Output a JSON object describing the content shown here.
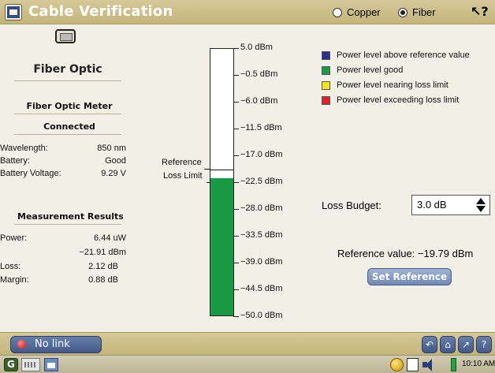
{
  "window": {
    "title": "Cable Verification",
    "app_icon": "window-icon",
    "help_icon": "help-arrow-icon"
  },
  "media": {
    "options": [
      {
        "label": "Copper",
        "selected": false
      },
      {
        "label": "Fiber",
        "selected": true
      }
    ]
  },
  "left_panel": {
    "device_icon": "fiber-meter-icon",
    "title": "Fiber Optic",
    "meter_heading": "Fiber Optic Meter",
    "meter_status": "Connected",
    "info": [
      {
        "label": "Wavelength:",
        "value": "850 nm"
      },
      {
        "label": "Battery:",
        "value": "Good"
      },
      {
        "label": "Battery Voltage:",
        "value": "9.29 V"
      }
    ],
    "results_heading": "Measurement Results",
    "power_label": "Power:",
    "power_uw": "6.44  uW",
    "power_dbm": "−21.91 dBm",
    "loss_label": "Loss:",
    "loss_value": "2.12 dB",
    "margin_label": "Margin:",
    "margin_value": "0.88 dB"
  },
  "meter": {
    "scale_max_dbm": 5.0,
    "scale_min_dbm": -50.0,
    "level_dbm": -21.91,
    "reference_dbm": -19.79,
    "loss_limit_dbm": -22.5,
    "ticks": [
      "5.0 dBm",
      "−0.5 dBm",
      "−6.0 dBm",
      "−11.5 dBm",
      "−17.0 dBm",
      "−22.5 dBm",
      "−28.0 dBm",
      "−33.5 dBm",
      "−39.0 dBm",
      "−44.5 dBm",
      "−50.0 dBm"
    ],
    "reference_label": "Reference",
    "loss_limit_label": "Loss Limit",
    "fill_color": "#199b46"
  },
  "legend": [
    {
      "color": "#2b2f8f",
      "label": "Power level above reference value"
    },
    {
      "color": "#199b46",
      "label": "Power level good"
    },
    {
      "color": "#f2e313",
      "label": "Power level nearing loss limit"
    },
    {
      "color": "#e3202b",
      "label": "Power level exceeding loss limit"
    }
  ],
  "loss_budget": {
    "label": "Loss Budget:",
    "value": "3.0 dB"
  },
  "reference": {
    "text": "Reference value: −19.79 dBm",
    "button": "Set Reference"
  },
  "status": {
    "link_label": "No link",
    "nav_icons": [
      "back-icon",
      "home-icon",
      "tools-icon",
      "help-icon"
    ],
    "nav_glyphs": [
      "↶",
      "⌂",
      "↗",
      "?"
    ]
  },
  "taskbar": {
    "time": "10:10 AM"
  }
}
